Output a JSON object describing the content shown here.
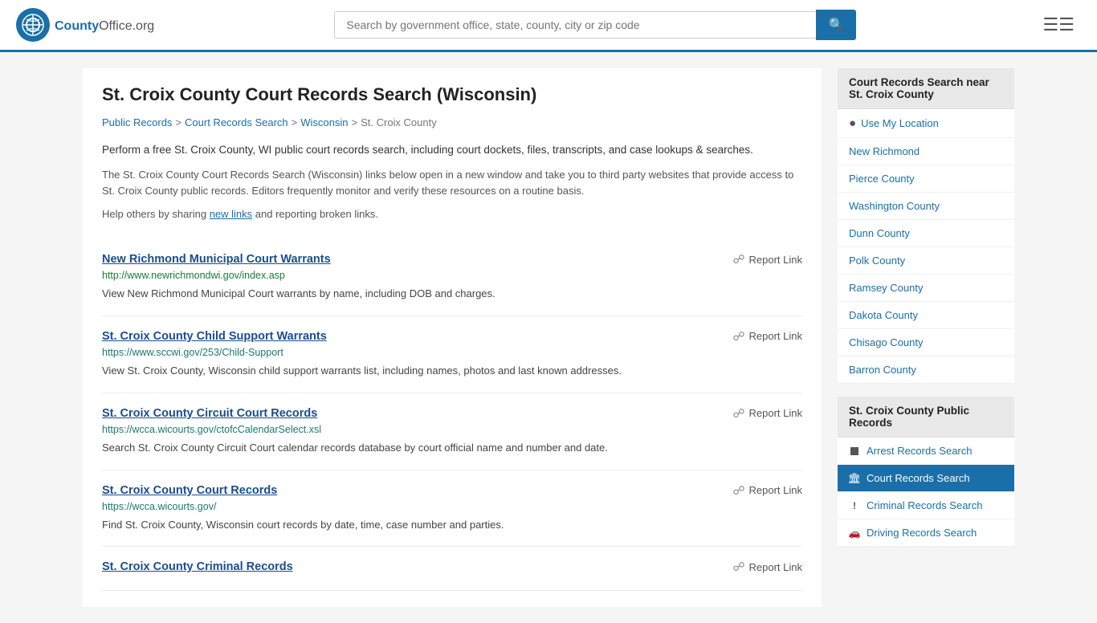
{
  "header": {
    "logo_text": "County",
    "logo_suffix": "Office.org",
    "search_placeholder": "Search by government office, state, county, city or zip code"
  },
  "page": {
    "title": "St. Croix County Court Records Search (Wisconsin)",
    "breadcrumb": [
      {
        "label": "Public Records",
        "href": "#"
      },
      {
        "label": "Court Records Search",
        "href": "#"
      },
      {
        "label": "Wisconsin",
        "href": "#"
      },
      {
        "label": "St. Croix County",
        "href": "#"
      }
    ],
    "intro1": "Perform a free St. Croix County, WI public court records search, including court dockets, files, transcripts, and case lookups & searches.",
    "intro2": "The St. Croix County Court Records Search (Wisconsin) links below open in a new window and take you to third party websites that provide access to St. Croix County public records. Editors frequently monitor and verify these resources on a routine basis.",
    "help_text": "Help others by sharing ",
    "new_links": "new links",
    "help_text2": " and reporting broken links."
  },
  "results": [
    {
      "title": "New Richmond Municipal Court Warrants",
      "url": "http://www.newrichmondwi.gov/index.asp",
      "url_color": "green",
      "desc": "View New Richmond Municipal Court warrants by name, including DOB and charges.",
      "report_label": "Report Link"
    },
    {
      "title": "St. Croix County Child Support Warrants",
      "url": "https://www.sccwi.gov/253/Child-Support",
      "url_color": "teal",
      "desc": "View St. Croix County, Wisconsin child support warrants list, including names, photos and last known addresses.",
      "report_label": "Report Link"
    },
    {
      "title": "St. Croix County Circuit Court Records",
      "url": "https://wcca.wicourts.gov/ctofcCalendarSelect.xsl",
      "url_color": "teal",
      "desc": "Search St. Croix County Circuit Court calendar records database by court official name and number and date.",
      "report_label": "Report Link"
    },
    {
      "title": "St. Croix County Court Records",
      "url": "https://wcca.wicourts.gov/",
      "url_color": "teal",
      "desc": "Find St. Croix County, Wisconsin court records by date, time, case number and parties.",
      "report_label": "Report Link"
    },
    {
      "title": "St. Croix County Criminal Records",
      "url": "",
      "url_color": "green",
      "desc": "",
      "report_label": "Report Link"
    }
  ],
  "sidebar": {
    "nearby_title": "Court Records Search near St. Croix County",
    "use_location": "Use My Location",
    "nearby_items": [
      "New Richmond",
      "Pierce County",
      "Washington County",
      "Dunn County",
      "Polk County",
      "Ramsey County",
      "Dakota County",
      "Chisago County",
      "Barron County"
    ],
    "public_records_title": "St. Croix County Public Records",
    "public_items": [
      {
        "label": "Arrest Records Search",
        "icon": "square",
        "active": false
      },
      {
        "label": "Court Records Search",
        "icon": "building",
        "active": true
      },
      {
        "label": "Criminal Records Search",
        "icon": "exclaim",
        "active": false
      },
      {
        "label": "Driving Records Search",
        "icon": "car",
        "active": false
      }
    ]
  }
}
